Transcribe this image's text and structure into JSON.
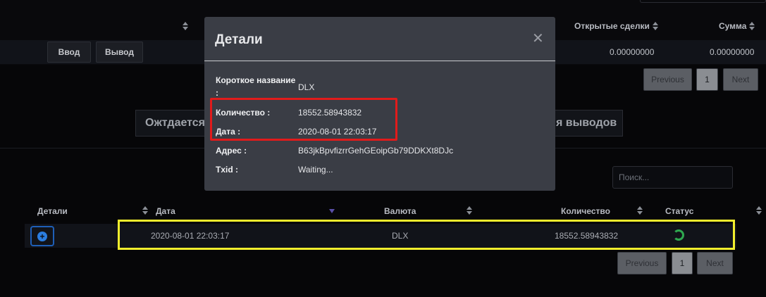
{
  "top_table": {
    "headers": [
      "Открытые сделки",
      "Сумма"
    ],
    "deposit_label": "Ввод",
    "withdraw_label": "Вывод",
    "row_values": [
      "0.00000000",
      "0.00000000"
    ]
  },
  "pagination": {
    "previous": "Previous",
    "page": "1",
    "next": "Next"
  },
  "tabs": {
    "pending_partial": "Ожтдается",
    "withdrawals_partial": "я выводов"
  },
  "search": {
    "placeholder": "Поиск..."
  },
  "transactions_table": {
    "headers": {
      "details": "Детали",
      "date": "Дата",
      "currency": "Валюта",
      "amount": "Количество",
      "status": "Статус"
    },
    "rows": [
      {
        "date": "2020-08-01 22:03:17",
        "currency": "DLX",
        "amount": "18552.58943832",
        "status_icon": "loading-spinner-icon"
      }
    ]
  },
  "modal": {
    "title": "Детали",
    "close_icon": "close-icon",
    "fields": [
      {
        "label_line1": "Короткое название",
        "label_line2": ":",
        "value": "DLX"
      },
      {
        "label": "Количество :",
        "value": "18552.58943832"
      },
      {
        "label": "Дата :",
        "value": "2020-08-01 22:03:17"
      },
      {
        "label": "Адрес :",
        "value": "B63jkBpvfizrrGehGEoipGb79DDKXt8DJc"
      },
      {
        "label": "Txid :",
        "value": "Waiting..."
      }
    ]
  },
  "colors": {
    "highlight_red": "#e11b1b",
    "highlight_yellow": "#f2ee2d",
    "accent_blue": "#2b7de0",
    "status_green": "#2fa84f"
  }
}
